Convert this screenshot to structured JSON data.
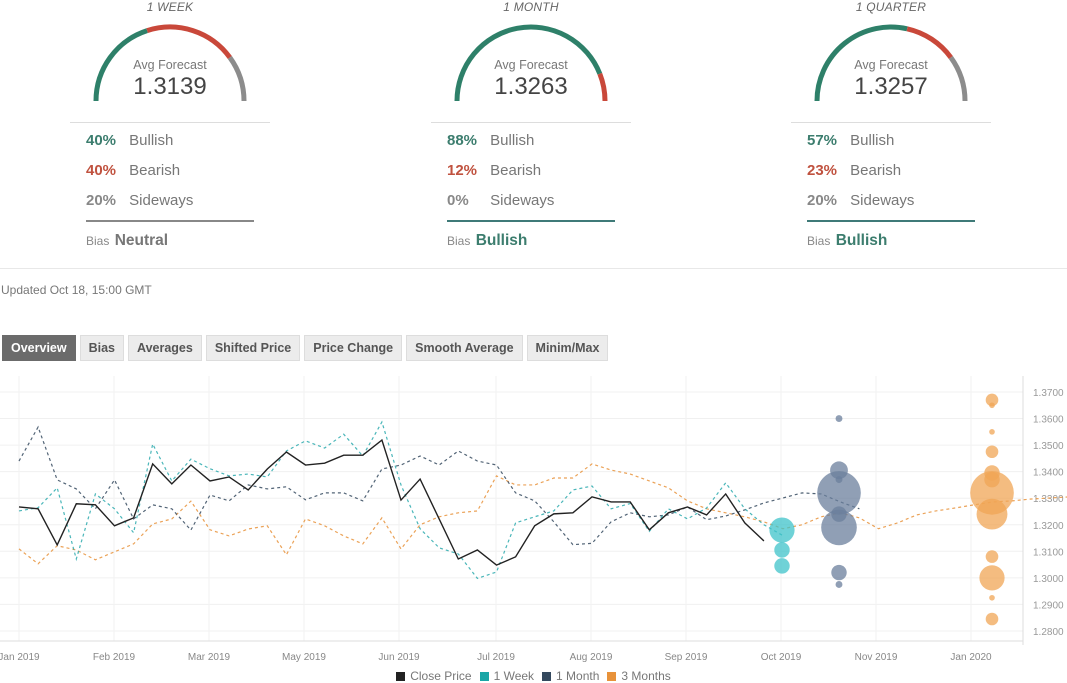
{
  "gauges": [
    {
      "title": "1 WEEK",
      "avg_label": "Avg Forecast",
      "avg_value": "1.3139",
      "rows": [
        {
          "pct": "40%",
          "label": "Bullish",
          "kind": "bull"
        },
        {
          "pct": "40%",
          "label": "Bearish",
          "kind": "bear"
        },
        {
          "pct": "20%",
          "label": "Sideways",
          "kind": "side"
        }
      ],
      "split": {
        "bullish": 40,
        "bearish": 40,
        "sideways": 20
      },
      "bias_label": "Bias",
      "bias_value": "Neutral",
      "bias_color": "#777777"
    },
    {
      "title": "1 MONTH",
      "avg_label": "Avg Forecast",
      "avg_value": "1.3263",
      "rows": [
        {
          "pct": "88%",
          "label": "Bullish",
          "kind": "bull"
        },
        {
          "pct": "12%",
          "label": "Bearish",
          "kind": "bear"
        },
        {
          "pct": "0%",
          "label": "Sideways",
          "kind": "side"
        }
      ],
      "split": {
        "bullish": 88,
        "bearish": 12,
        "sideways": 0
      },
      "bias_label": "Bias",
      "bias_value": "Bullish",
      "bias_color": "#3c7d6e"
    },
    {
      "title": "1 QUARTER",
      "avg_label": "Avg Forecast",
      "avg_value": "1.3257",
      "rows": [
        {
          "pct": "57%",
          "label": "Bullish",
          "kind": "bull"
        },
        {
          "pct": "23%",
          "label": "Bearish",
          "kind": "bear"
        },
        {
          "pct": "20%",
          "label": "Sideways",
          "kind": "side"
        }
      ],
      "split": {
        "bullish": 57,
        "bearish": 23,
        "sideways": 20
      },
      "bias_label": "Bias",
      "bias_value": "Bullish",
      "bias_color": "#3c7d6e"
    }
  ],
  "colors": {
    "bullish": "#2e8069",
    "bearish": "#c9483a",
    "sideways": "#8c8c8c",
    "neutral_line": "#888888",
    "bullish_line": "#3f7a78"
  },
  "updated": "Updated Oct 18, 15:00 GMT",
  "tabs": [
    {
      "label": "Overview",
      "active": true
    },
    {
      "label": "Bias"
    },
    {
      "label": "Averages"
    },
    {
      "label": "Shifted Price"
    },
    {
      "label": "Price Change"
    },
    {
      "label": "Smooth Average"
    },
    {
      "label": "Minim/Max"
    }
  ],
  "chart_data": {
    "type": "line",
    "title": "",
    "xlabel": "",
    "ylabel": "",
    "ylim": [
      1.275,
      1.373
    ],
    "yticks": [
      "1.3700",
      "1.3600",
      "1.3500",
      "1.3400",
      "1.3300",
      "1.3200",
      "1.3100",
      "1.3000",
      "1.2900",
      "1.2800"
    ],
    "xticks": [
      "Jan 2019",
      "Feb 2019",
      "Mar 2019",
      "May 2019",
      "Jun 2019",
      "Jul 2019",
      "Aug 2019",
      "Sep 2019",
      "Oct 2019",
      "Nov 2019",
      "Jan 2020"
    ],
    "grid": true,
    "legend_position": "bottom",
    "legend": [
      {
        "name": "Close Price",
        "color": "#222222"
      },
      {
        "name": "1 Week",
        "color": "#1aa6a6"
      },
      {
        "name": "1 Month",
        "color": "#34495e"
      },
      {
        "name": "3 Months",
        "color": "#e8923a"
      }
    ],
    "series": [
      {
        "name": "Close Price",
        "style": "solid",
        "color": "#222222",
        "x": [
          0,
          1,
          2,
          3,
          4,
          5,
          6,
          7,
          8,
          9,
          10,
          11,
          12,
          13,
          14,
          15,
          16,
          17,
          18,
          19,
          20,
          21,
          23,
          24,
          25,
          26,
          27,
          28,
          29,
          30,
          31,
          32,
          33,
          34,
          35,
          36,
          37,
          38,
          39
        ],
        "values": [
          1.3267,
          1.326,
          1.3124,
          1.3279,
          1.3275,
          1.3196,
          1.3226,
          1.3429,
          1.3354,
          1.3425,
          1.3365,
          1.338,
          1.3331,
          1.341,
          1.3474,
          1.3425,
          1.3432,
          1.3462,
          1.3462,
          1.3519,
          1.3293,
          1.3372,
          1.3071,
          1.3105,
          1.3048,
          1.3079,
          1.3196,
          1.3241,
          1.3245,
          1.3305,
          1.3286,
          1.3286,
          1.3181,
          1.3245,
          1.3267,
          1.3237,
          1.3316,
          1.3207,
          1.3139
        ]
      },
      {
        "name": "1 Week",
        "style": "dashed",
        "color": "#2aa9ad",
        "x": [
          0,
          1,
          2,
          3,
          4,
          5,
          6,
          7,
          8,
          9,
          10,
          11,
          12,
          13,
          14,
          15,
          16,
          17,
          18,
          19,
          20,
          21,
          22,
          23,
          24,
          25,
          26,
          27,
          28,
          29,
          30,
          31,
          32,
          33,
          34,
          35,
          36,
          37,
          38,
          39,
          40
        ],
        "values": [
          1.3252,
          1.3264,
          1.3339,
          1.3071,
          1.3316,
          1.326,
          1.317,
          1.3504,
          1.3365,
          1.3447,
          1.3411,
          1.3384,
          1.3391,
          1.338,
          1.3478,
          1.3516,
          1.3489,
          1.3541,
          1.3459,
          1.3587,
          1.335,
          1.3185,
          1.3113,
          1.309,
          1.2998,
          1.3022,
          1.3207,
          1.323,
          1.3252,
          1.3331,
          1.3346,
          1.326,
          1.328,
          1.3175,
          1.326,
          1.3222,
          1.3263,
          1.3358,
          1.326,
          1.32,
          1.3159
        ]
      },
      {
        "name": "1 Month",
        "style": "dashed",
        "color": "#34495e",
        "x": [
          0,
          1,
          2,
          3,
          4,
          5,
          6,
          7,
          8,
          9,
          10,
          11,
          12,
          13,
          14,
          15,
          16,
          17,
          18,
          19,
          20,
          21,
          22,
          23,
          24,
          25,
          26,
          27,
          28,
          29,
          30,
          31,
          32,
          33,
          34,
          35,
          36,
          37,
          38,
          39,
          40,
          41,
          42,
          43,
          44
        ],
        "values": [
          1.344,
          1.3568,
          1.3369,
          1.3335,
          1.326,
          1.3369,
          1.3222,
          1.3275,
          1.326,
          1.318,
          1.3312,
          1.329,
          1.335,
          1.3335,
          1.3343,
          1.3294,
          1.332,
          1.332,
          1.329,
          1.341,
          1.3425,
          1.3459,
          1.3425,
          1.3478,
          1.344,
          1.3425,
          1.332,
          1.329,
          1.3211,
          1.3125,
          1.313,
          1.3211,
          1.3245,
          1.323,
          1.3237,
          1.3267,
          1.3219,
          1.3233,
          1.3256,
          1.3282,
          1.3301,
          1.332,
          1.3316,
          1.3286,
          1.326
        ]
      },
      {
        "name": "3 Months",
        "style": "dashed",
        "color": "#e8923a",
        "x": [
          0,
          1,
          2,
          3,
          4,
          5,
          6,
          7,
          8,
          9,
          10,
          11,
          12,
          13,
          14,
          15,
          16,
          17,
          18,
          19,
          20,
          21,
          22,
          23,
          24,
          25,
          26,
          27,
          28,
          29,
          30,
          31,
          32,
          33,
          34,
          35,
          36,
          37,
          38,
          39,
          40,
          41,
          42,
          43,
          44,
          45,
          46,
          47,
          48,
          49,
          50,
          51,
          52,
          53,
          54,
          55,
          56,
          57
        ],
        "values": [
          1.3109,
          1.3053,
          1.3121,
          1.3105,
          1.3068,
          1.3098,
          1.3128,
          1.3203,
          1.3222,
          1.3289,
          1.3181,
          1.3158,
          1.3184,
          1.3196,
          1.3087,
          1.3222,
          1.3196,
          1.3158,
          1.3128,
          1.3226,
          1.3109,
          1.32,
          1.323,
          1.3245,
          1.3252,
          1.3384,
          1.335,
          1.335,
          1.3376,
          1.3376,
          1.3429,
          1.3406,
          1.3391,
          1.3365,
          1.3339,
          1.329,
          1.326,
          1.3245,
          1.323,
          1.3211,
          1.3185,
          1.32,
          1.323,
          1.3245,
          1.3226,
          1.3185,
          1.3207,
          1.3237,
          1.3252,
          1.3263,
          1.3275,
          1.3286,
          1.329,
          1.3297,
          1.3301,
          1.3305,
          1.329,
          1.3257
        ]
      }
    ],
    "forecast_bubbles": [
      {
        "series": "1 Week",
        "color": "#3fc3c9",
        "points": [
          {
            "value": 1.318,
            "weight": 4
          },
          {
            "value": 1.3105,
            "weight": 1.5
          },
          {
            "value": 1.3045,
            "weight": 1.5
          }
        ]
      },
      {
        "series": "1 Month",
        "color": "#6b7f9c",
        "points": [
          {
            "value": 1.36,
            "weight": 0.3
          },
          {
            "value": 1.3405,
            "weight": 2
          },
          {
            "value": 1.332,
            "weight": 12
          },
          {
            "value": 1.319,
            "weight": 8
          },
          {
            "value": 1.324,
            "weight": 1.5
          },
          {
            "value": 1.302,
            "weight": 1.5
          },
          {
            "value": 1.2975,
            "weight": 0.3
          },
          {
            "value": 1.337,
            "weight": 0.3
          }
        ]
      },
      {
        "series": "3 Months",
        "color": "#f0a556",
        "points": [
          {
            "value": 1.367,
            "weight": 1
          },
          {
            "value": 1.365,
            "weight": 0.2
          },
          {
            "value": 1.355,
            "weight": 0.2
          },
          {
            "value": 1.3475,
            "weight": 1
          },
          {
            "value": 1.3395,
            "weight": 1.5
          },
          {
            "value": 1.332,
            "weight": 12
          },
          {
            "value": 1.324,
            "weight": 6
          },
          {
            "value": 1.337,
            "weight": 1.5
          },
          {
            "value": 1.308,
            "weight": 1
          },
          {
            "value": 1.3,
            "weight": 4
          },
          {
            "value": 1.2925,
            "weight": 0.2
          },
          {
            "value": 1.2845,
            "weight": 1
          }
        ]
      }
    ]
  }
}
